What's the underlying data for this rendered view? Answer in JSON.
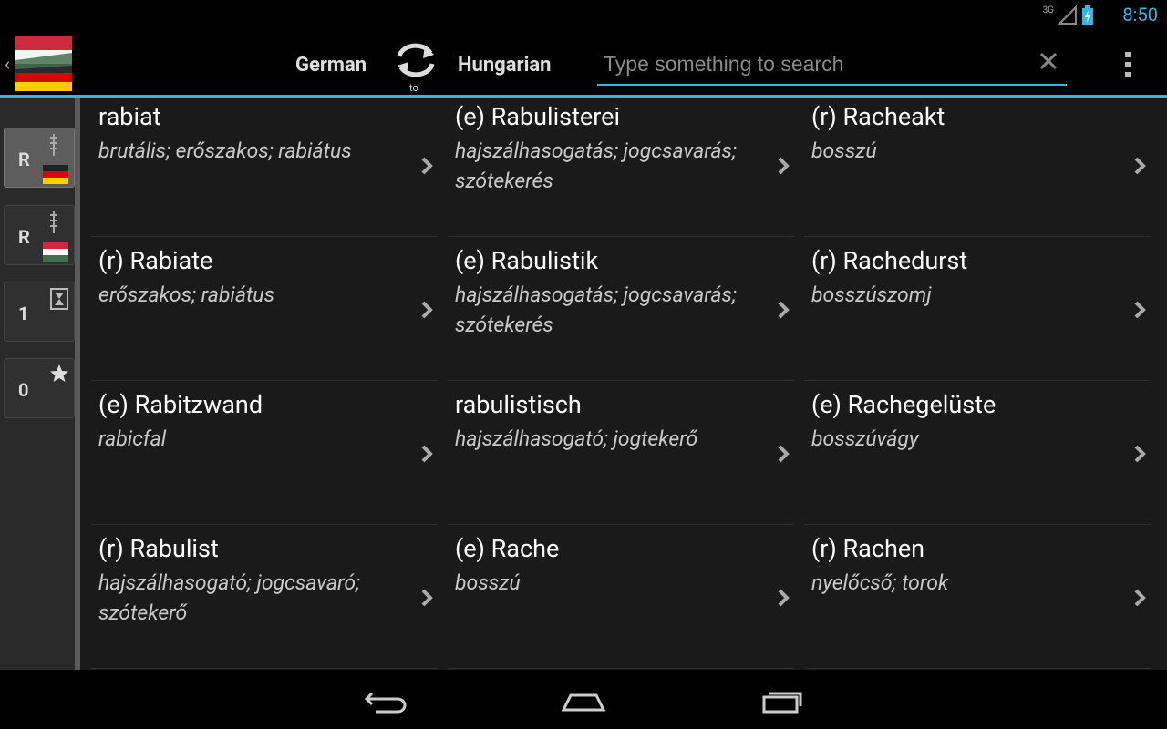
{
  "status_bar": {
    "time": "8:50",
    "network_label": "3G",
    "accent_color": "#33b5e5"
  },
  "action_bar": {
    "from_language": "German",
    "to_language": "Hungarian",
    "swap_label": "to",
    "search": {
      "value": "",
      "placeholder": "Type something to search"
    }
  },
  "sidebar": {
    "tabs": [
      {
        "label": "R",
        "icon": "german-flag-index-icon",
        "active": true
      },
      {
        "label": "R",
        "icon": "hungarian-flag-index-icon",
        "active": false
      },
      {
        "label": "1",
        "icon": "history-icon",
        "active": false
      },
      {
        "label": "0",
        "icon": "star-icon",
        "active": false
      }
    ]
  },
  "entries": [
    {
      "headword": "rabiat",
      "translation": "brutális; erőszakos; rabiátus"
    },
    {
      "headword": "(e) Rabulisterei",
      "translation": "hajszálhasogatás; jogcsavarás; szótekerés"
    },
    {
      "headword": "(r) Racheakt",
      "translation": "bosszú"
    },
    {
      "headword": "(r) Rabiate",
      "translation": "erőszakos; rabiátus"
    },
    {
      "headword": "(e) Rabulistik",
      "translation": "hajszálhasogatás; jogcsavarás; szótekerés"
    },
    {
      "headword": "(r) Rachedurst",
      "translation": "bosszúszomj"
    },
    {
      "headword": "(e) Rabitzwand",
      "translation": "rabicfal"
    },
    {
      "headword": "rabulistisch",
      "translation": "hajszálhasogató; jogtekerő"
    },
    {
      "headword": "(e) Rachegelüste",
      "translation": "bosszúvágy"
    },
    {
      "headword": "(r) Rabulist",
      "translation": "hajszálhasogató; jogcsavaró; szótekerő"
    },
    {
      "headword": "(e) Rache",
      "translation": "bosszú"
    },
    {
      "headword": "(r) Rachen",
      "translation": "nyelőcső; torok"
    }
  ],
  "nav_bar": {
    "buttons": [
      "back-icon",
      "home-icon",
      "recent-apps-icon"
    ]
  }
}
